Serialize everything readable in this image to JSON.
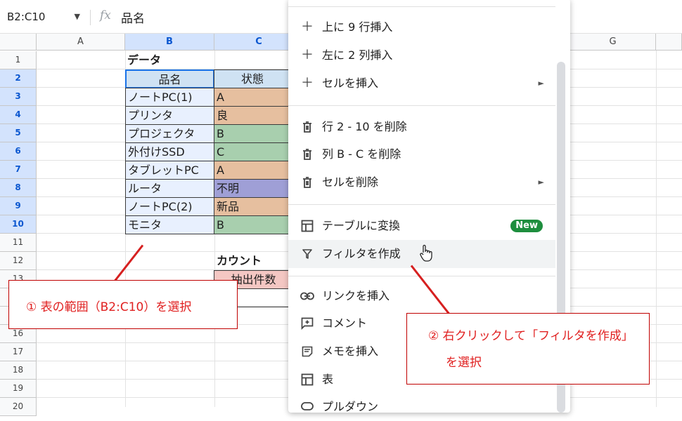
{
  "formula_bar": {
    "name_box": "B2:C10",
    "fx": "fx",
    "value": "品名"
  },
  "columns": [
    "A",
    "B",
    "C",
    "G"
  ],
  "rows": [
    "1",
    "2",
    "3",
    "4",
    "5",
    "6",
    "7",
    "8",
    "9",
    "10",
    "11",
    "12",
    "13",
    "14",
    "15",
    "16",
    "17",
    "18",
    "19",
    "20"
  ],
  "sheet": {
    "title": "データ",
    "header": {
      "name": "品名",
      "status": "状態"
    },
    "items": [
      {
        "name": "ノートPC(1)",
        "status": "A"
      },
      {
        "name": "プリンタ",
        "status": "良"
      },
      {
        "name": "プロジェクタ",
        "status": "B"
      },
      {
        "name": "外付けSSD",
        "status": "C"
      },
      {
        "name": "タブレットPC",
        "status": "A"
      },
      {
        "name": "ルータ",
        "status": "不明"
      },
      {
        "name": "ノートPC(2)",
        "status": "新品"
      },
      {
        "name": "モニタ",
        "status": "B"
      }
    ],
    "count_title": "カウント",
    "count_header": "抽出件数"
  },
  "menu": {
    "insert_rows": "上に 9 行挿入",
    "insert_cols": "左に 2 列挿入",
    "insert_cells": "セルを挿入",
    "delete_rows": "行 2 - 10 を削除",
    "delete_cols": "列 B - C を削除",
    "delete_cells": "セルを削除",
    "convert_table": "テーブルに変換",
    "new_badge": "New",
    "create_filter": "フィルタを作成",
    "insert_link": "リンクを挿入",
    "comment": "コメント",
    "insert_note": "メモを挿入",
    "table": "表",
    "dropdown": "プルダウン"
  },
  "callouts": {
    "step1": "① 表の範囲（B2:C10）を選択",
    "step2_line1": "② 右クリックして「フィルタを作成」",
    "step2_line2": "を選択"
  },
  "colors": {
    "accent_green": "#1e8e3e",
    "callout_red": "#e02020",
    "selection_blue": "#d3e3fd"
  }
}
